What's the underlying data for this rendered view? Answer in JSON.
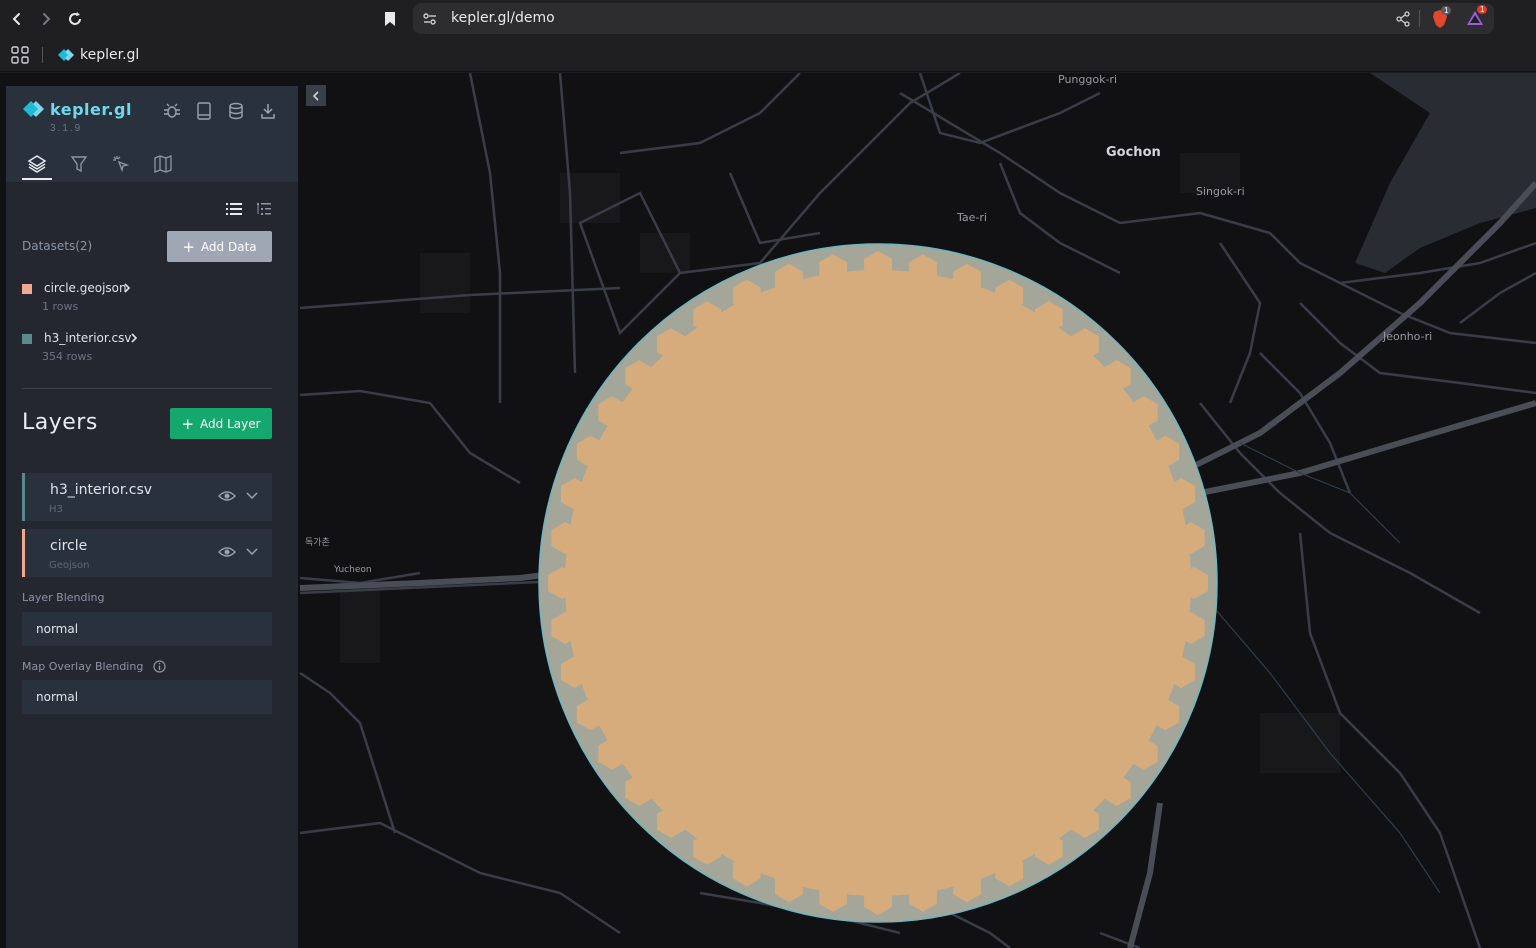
{
  "browser": {
    "url": "kepler.gl/demo",
    "bookmark_label": "kepler.gl",
    "brave_badge": "1",
    "alert_badge": "1"
  },
  "map": {
    "labels": [
      {
        "text": "Punggok-ri",
        "big": false
      },
      {
        "text": "Gochon",
        "big": true
      },
      {
        "text": "Singok-ri",
        "big": false
      },
      {
        "text": "Tae-ri",
        "big": false
      },
      {
        "text": "Jeonho-ri",
        "big": false
      },
      {
        "text": "독가촌",
        "big": false
      },
      {
        "text": "Yucheon",
        "big": false
      }
    ],
    "circle_fill": "#d6ac7c",
    "circle_outline": "#a4a69a",
    "background": "#111113",
    "road_color": "#3a3c48"
  },
  "sidebar": {
    "logo": "kepler.gl",
    "version": "3.1.9",
    "datasets_label": "Datasets(2)",
    "add_data_label": "Add Data",
    "datasets": [
      {
        "name": "circle.geojson",
        "rows": "1 rows",
        "color": "#f0a890"
      },
      {
        "name": "h3_interior.csv",
        "rows": "354 rows",
        "color": "#5b8a8c"
      }
    ],
    "layers_title": "Layers",
    "add_layer_label": "Add Layer",
    "layers": [
      {
        "name": "h3_interior.csv",
        "type": "H3",
        "color": "#5b8a8c"
      },
      {
        "name": "circle",
        "type": "Geojson",
        "color": "#f0a890"
      }
    ],
    "layer_blending_label": "Layer Blending",
    "layer_blending_value": "normal",
    "map_overlay_label": "Map Overlay Blending",
    "map_overlay_value": "normal"
  }
}
